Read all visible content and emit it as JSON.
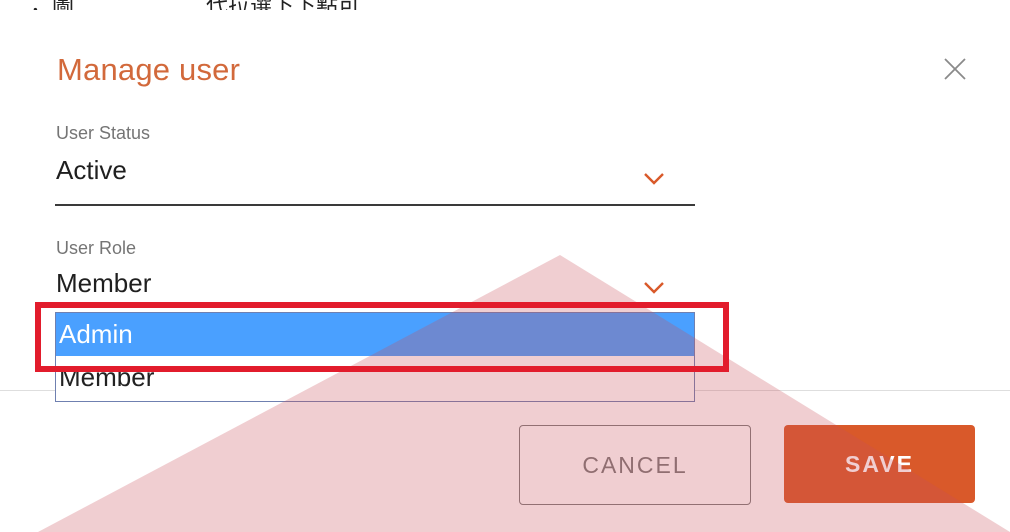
{
  "top_fragment": "，圖　　　　　　代拉選下下點可",
  "dialog": {
    "title": "Manage user",
    "close_icon": "close-icon"
  },
  "fields": {
    "status": {
      "label": "User Status",
      "value": "Active",
      "icon": "chevron-down-icon"
    },
    "role": {
      "label": "User Role",
      "value": "Member",
      "icon": "chevron-down-icon"
    }
  },
  "role_dropdown": {
    "options": [
      {
        "label": "Admin",
        "selected": true
      },
      {
        "label": "Member",
        "selected": false
      }
    ]
  },
  "buttons": {
    "cancel_label": "CANCEL",
    "save_label": "SAVE"
  },
  "colors": {
    "title": "#d2693b",
    "accent": "#d9592a",
    "selection": "#4aa0ff",
    "highlight_box": "#e21c2c"
  }
}
